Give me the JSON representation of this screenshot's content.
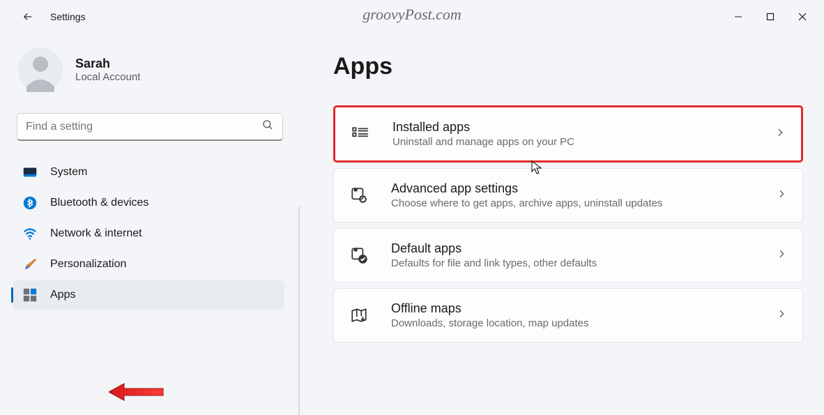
{
  "window": {
    "title": "Settings"
  },
  "watermark": "groovyPost.com",
  "account": {
    "name": "Sarah",
    "subtitle": "Local Account"
  },
  "search": {
    "placeholder": "Find a setting"
  },
  "nav": {
    "items": [
      {
        "label": "System"
      },
      {
        "label": "Bluetooth & devices"
      },
      {
        "label": "Network & internet"
      },
      {
        "label": "Personalization"
      },
      {
        "label": "Apps"
      }
    ]
  },
  "page": {
    "title": "Apps"
  },
  "cards": [
    {
      "title": "Installed apps",
      "subtitle": "Uninstall and manage apps on your PC"
    },
    {
      "title": "Advanced app settings",
      "subtitle": "Choose where to get apps, archive apps, uninstall updates"
    },
    {
      "title": "Default apps",
      "subtitle": "Defaults for file and link types, other defaults"
    },
    {
      "title": "Offline maps",
      "subtitle": "Downloads, storage location, map updates"
    }
  ]
}
